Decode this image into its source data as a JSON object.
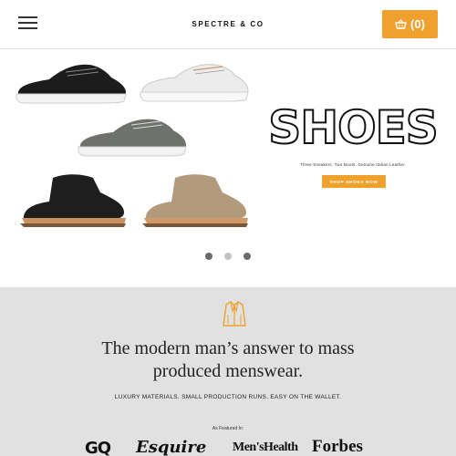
{
  "header": {
    "brand": "SPECTRE & CO",
    "cart_label": "(0)",
    "accent_color": "#f0a02c"
  },
  "hero": {
    "title": "SHOES",
    "subtitle": "Three Sneakers. Two Boots. Genuine Italian Leather.",
    "cta_label": "SHOP SHOES NOW",
    "products": [
      {
        "name": "black-sneaker",
        "color": "#1c1c1c"
      },
      {
        "name": "white-sneaker",
        "color": "#eeeeee"
      },
      {
        "name": "gray-sneaker",
        "color": "#6e716c"
      },
      {
        "name": "black-boot",
        "color": "#1e1e1e"
      },
      {
        "name": "tan-boot",
        "color": "#b49a7c"
      }
    ]
  },
  "carousel": {
    "active_index": 0,
    "count": 3
  },
  "featured": {
    "headline_line1": "The modern man’s answer to mass",
    "headline_line2": "produced menswear.",
    "tagline": "LUXURY MATERIALS. SMALL PRODUCTION RUNS. EASY ON THE WALLET.",
    "as_featured_label": "As Featured In:",
    "press_logos": [
      "GQ",
      "Esquire",
      "Men'sHealth",
      "Forbes"
    ]
  },
  "icons": {
    "menu": "hamburger-icon",
    "cart": "basket-icon",
    "section": "jacket-icon"
  }
}
